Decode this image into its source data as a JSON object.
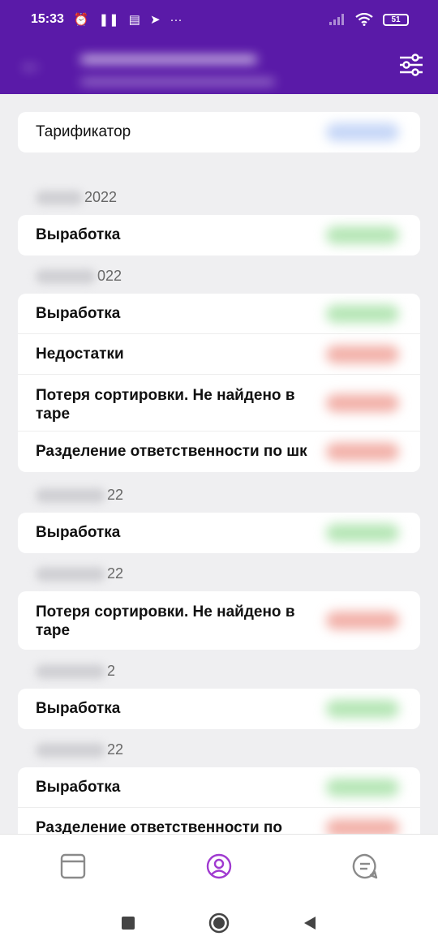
{
  "status_bar": {
    "time": "15:33",
    "battery": "51",
    "more": "···"
  },
  "colors": {
    "primary": "#5a1aa8",
    "accent": "#a03ad0",
    "positive": "#b5e6b5",
    "negative": "#f2b0a8",
    "info": "#c5d6f7"
  },
  "header_card": {
    "label": "Тарификатор"
  },
  "groups": [
    {
      "date_suffix": "2022",
      "rows": [
        {
          "label": "Выработка",
          "sign": "positive"
        }
      ]
    },
    {
      "date_suffix": "022",
      "rows": [
        {
          "label": "Выработка",
          "sign": "positive"
        },
        {
          "label": "Недостатки",
          "sign": "negative"
        },
        {
          "label": "Потеря сортировки. Не найдено в таре",
          "sign": "negative"
        },
        {
          "label": "Разделение ответственности по шк",
          "sign": "negative"
        }
      ]
    },
    {
      "date_suffix": "22",
      "rows": [
        {
          "label": "Выработка",
          "sign": "positive"
        }
      ]
    },
    {
      "date_suffix": "22",
      "rows": [
        {
          "label": "Потеря сортировки. Не найдено в таре",
          "sign": "negative"
        }
      ]
    },
    {
      "date_suffix": "2",
      "rows": [
        {
          "label": "Выработка",
          "sign": "positive"
        }
      ]
    },
    {
      "date_suffix": "22",
      "rows": [
        {
          "label": "Выработка",
          "sign": "positive"
        },
        {
          "label": "Разделение ответственности по",
          "sign": "negative"
        }
      ]
    }
  ],
  "icons": {
    "back": "arrow-back-icon",
    "filter": "sliders-icon",
    "nav_tab_1": "window-icon",
    "nav_tab_2": "user-circle-icon",
    "nav_tab_3": "chat-icon",
    "sys_recent": "square-icon",
    "sys_home": "circle-icon",
    "sys_back": "triangle-back-icon"
  }
}
